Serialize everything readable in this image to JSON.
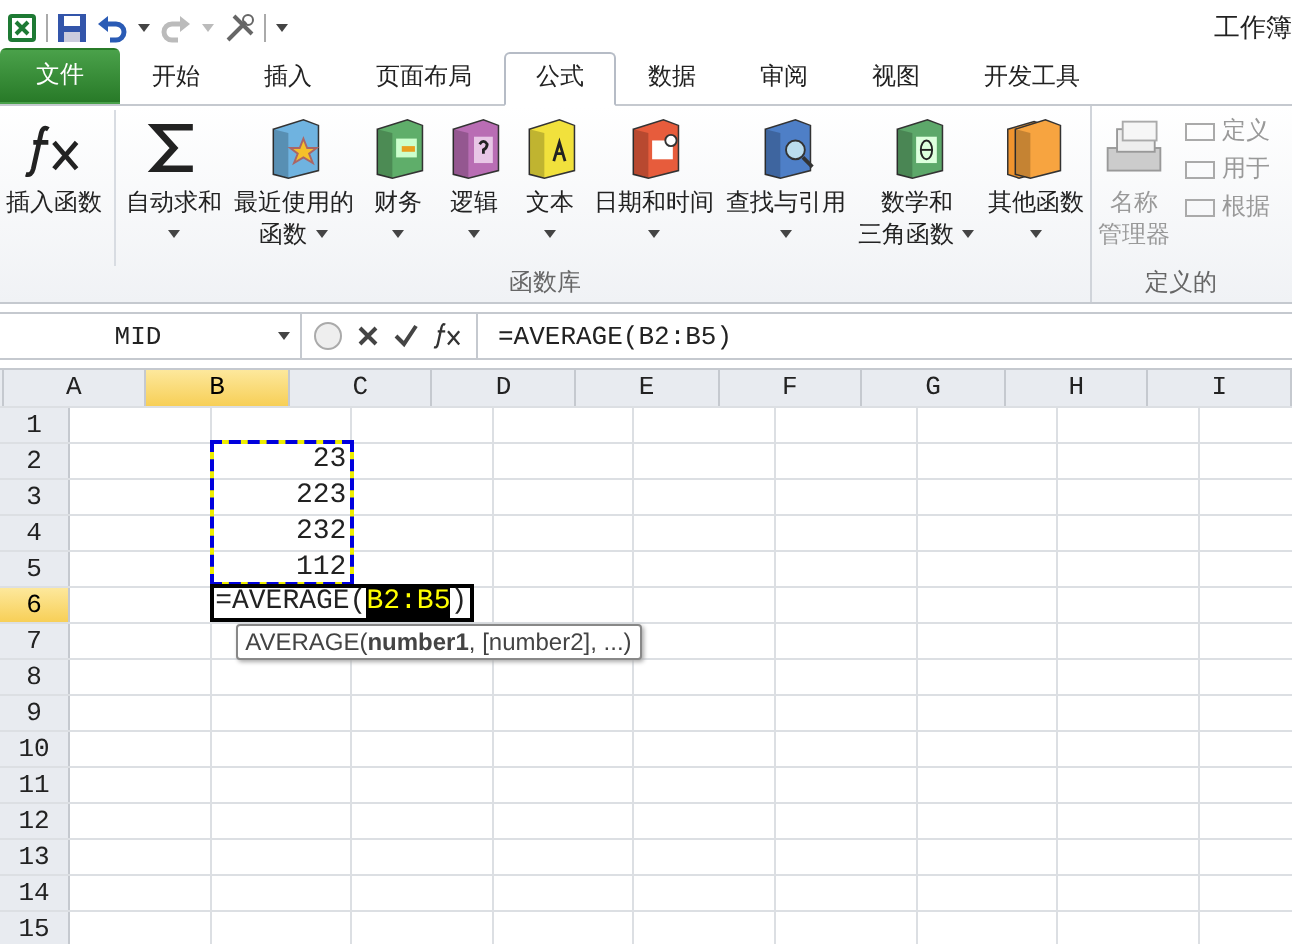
{
  "window": {
    "title": "工作簿"
  },
  "tabs": [
    {
      "label": "文件",
      "kind": "file",
      "selected": false
    },
    {
      "label": "开始",
      "kind": "tab",
      "selected": false
    },
    {
      "label": "插入",
      "kind": "tab",
      "selected": false
    },
    {
      "label": "页面布局",
      "kind": "tab",
      "selected": false
    },
    {
      "label": "公式",
      "kind": "tab",
      "selected": true
    },
    {
      "label": "数据",
      "kind": "tab",
      "selected": false
    },
    {
      "label": "审阅",
      "kind": "tab",
      "selected": false
    },
    {
      "label": "视图",
      "kind": "tab",
      "selected": false
    },
    {
      "label": "开发工具",
      "kind": "tab",
      "selected": false
    }
  ],
  "function_library": {
    "label": "函数库",
    "buttons": [
      {
        "kind": "fx",
        "lines": [
          "插入函数"
        ],
        "dropdown": false
      },
      {
        "kind": "sum",
        "lines": [
          "自动求和"
        ],
        "dropdown": true
      },
      {
        "kind": "star-book",
        "lines": [
          "最近使用的",
          "函数"
        ],
        "dropdown": true
      },
      {
        "kind": "money-book",
        "lines": [
          "财务"
        ],
        "dropdown": true
      },
      {
        "kind": "question-book",
        "lines": [
          "逻辑"
        ],
        "dropdown": true
      },
      {
        "kind": "letter-book",
        "lines": [
          "文本"
        ],
        "dropdown": true
      },
      {
        "kind": "calendar-book",
        "lines": [
          "日期和时间"
        ],
        "dropdown": true
      },
      {
        "kind": "search-book",
        "lines": [
          "查找与引用"
        ],
        "dropdown": true
      },
      {
        "kind": "theta-book",
        "lines": [
          "数学和",
          "三角函数"
        ],
        "dropdown": true
      },
      {
        "kind": "books",
        "lines": [
          "其他函数"
        ],
        "dropdown": true
      }
    ]
  },
  "defined_names": {
    "label": "定义的",
    "manager": [
      "名称",
      "管理器"
    ],
    "items": [
      "定义",
      "用于",
      "根据"
    ]
  },
  "formula_bar": {
    "name_box": "MID",
    "formula": "=AVERAGE(B2:B5)"
  },
  "columns": [
    {
      "label": "A",
      "selected": false
    },
    {
      "label": "B",
      "selected": true
    },
    {
      "label": "C",
      "selected": false
    },
    {
      "label": "D",
      "selected": false
    },
    {
      "label": "E",
      "selected": false
    },
    {
      "label": "F",
      "selected": false
    },
    {
      "label": "G",
      "selected": false
    },
    {
      "label": "H",
      "selected": false
    },
    {
      "label": "I",
      "selected": false
    }
  ],
  "rows": [
    {
      "label": "1",
      "selected": false
    },
    {
      "label": "2",
      "selected": false,
      "cells": [
        null,
        {
          "value": "23",
          "in_reference": true
        }
      ]
    },
    {
      "label": "3",
      "selected": false,
      "cells": [
        null,
        {
          "value": "223",
          "in_reference": true
        }
      ]
    },
    {
      "label": "4",
      "selected": false,
      "cells": [
        null,
        {
          "value": "232",
          "in_reference": true
        }
      ]
    },
    {
      "label": "5",
      "selected": false,
      "cells": [
        null,
        {
          "value": "112",
          "in_reference": true
        }
      ]
    },
    {
      "label": "6",
      "selected": true
    },
    {
      "label": "7",
      "selected": false
    },
    {
      "label": "8",
      "selected": false
    },
    {
      "label": "9",
      "selected": false
    },
    {
      "label": "10",
      "selected": false
    },
    {
      "label": "11",
      "selected": false
    },
    {
      "label": "12",
      "selected": false
    },
    {
      "label": "13",
      "selected": false
    },
    {
      "label": "14",
      "selected": false
    },
    {
      "label": "15",
      "selected": false
    }
  ],
  "editing_cell": {
    "prefix": "=AVERAGE(",
    "reference": "B2:B5",
    "suffix": ")"
  },
  "tooltip": "AVERAGE(**number1**, [number2], ...)"
}
